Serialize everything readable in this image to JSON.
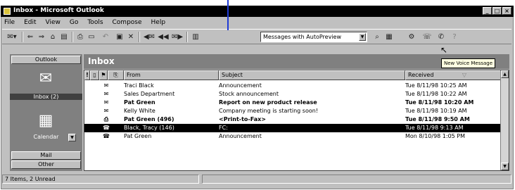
{
  "window": {
    "title": "Inbox - Microsoft Outlook",
    "caption_buttons": [
      "_",
      "□",
      "×"
    ]
  },
  "menu": [
    "File",
    "Edit",
    "View",
    "Go",
    "Tools",
    "Compose",
    "Help"
  ],
  "toolbar": {
    "view_select": "Messages with AutoPreview",
    "icons": [
      "new-message-icon",
      "back-icon",
      "forward-icon",
      "up-one-level-icon",
      "folder-list-icon",
      "print-icon",
      "print-preview-icon",
      "undo-icon",
      "move-to-folder-icon",
      "delete-icon",
      "reply-icon",
      "reply-all-icon",
      "forward-message-icon",
      "address-book-icon",
      "find-items-icon",
      "organize-icon",
      "new-voice-message-icon",
      "office-assistant-icon"
    ]
  },
  "outlook_bar": {
    "groups": [
      "Outlook",
      "Mail",
      "Other"
    ],
    "items": [
      {
        "label": "Inbox (2)",
        "icon": "inbox-icon"
      },
      {
        "label": "Calendar",
        "icon": "calendar-icon"
      }
    ]
  },
  "folder": {
    "name": "Inbox"
  },
  "columns": {
    "from": "From",
    "subject": "Subject",
    "received": "Received"
  },
  "messages": [
    {
      "from": "Traci Black",
      "subject": "Announcement",
      "received": "Tue 8/11/98 10:25 AM",
      "unread": false,
      "icon": "read-envelope-icon"
    },
    {
      "from": "Sales Department",
      "subject": "Stock announcement",
      "received": "Tue 8/11/98 10:22 AM",
      "unread": false,
      "icon": "read-envelope-icon"
    },
    {
      "from": "Pat Green",
      "subject": "Report on new product release",
      "received": "Tue 8/11/98 10:20 AM",
      "unread": true,
      "icon": "unread-envelope-icon"
    },
    {
      "from": "Kelly White",
      "subject": "Company meeting is starting soon!",
      "received": "Tue 8/11/98 10:19 AM",
      "unread": false,
      "icon": "read-envelope-icon"
    },
    {
      "from": "Pat Green (496)",
      "subject": "<Print-to-Fax>",
      "received": "Tue 8/11/98 9:50 AM",
      "unread": true,
      "icon": "fax-icon"
    },
    {
      "from": "Black, Tracy (146)",
      "subject": "FC:",
      "received": "Tue 8/11/98 9:13 AM",
      "unread": false,
      "selected": true,
      "icon": "voice-message-icon"
    },
    {
      "from": "Pat Green",
      "subject": "Announcement",
      "received": "Mon 8/10/98 1:05 PM",
      "unread": false,
      "icon": "voice-message-icon"
    }
  ],
  "tooltip": "New Voice Message",
  "status": "7 Items, 2 Unread"
}
